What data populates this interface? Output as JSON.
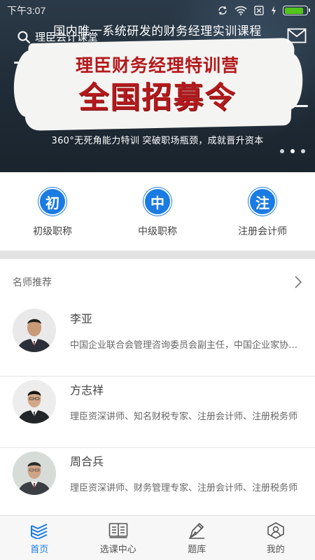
{
  "status_bar": {
    "time": "下午3:07",
    "battery_level": 0.85
  },
  "header": {
    "search_text": "理臣会计课堂"
  },
  "banner": {
    "top_line": "国内唯一系统研发的财务经理实训课程",
    "title_line1": "理臣财务经理特训营",
    "title_line2": "全国招募令",
    "subtitle": "360°无死角能力特训   突破职场瓶颈，成就晋升资本",
    "slide_count": 3,
    "active_slide": 2
  },
  "categories": [
    {
      "badge": "初",
      "label": "初级职称"
    },
    {
      "badge": "中",
      "label": "中级职称"
    },
    {
      "badge": "注",
      "label": "注册会计师"
    }
  ],
  "teachers_section": {
    "title": "名师推荐",
    "items": [
      {
        "name": "李亚",
        "desc": "中国企业联合会管理咨询委员会副主任，中国企业家协会理事"
      },
      {
        "name": "方志祥",
        "desc": "理臣资深讲师、知名财税专家、注册会计师、注册税务师"
      },
      {
        "name": "周合兵",
        "desc": "理臣资深讲师、财务管理专家、注册会计师、注册税务师"
      }
    ]
  },
  "bottom_nav": [
    {
      "label": "首页",
      "icon": "home-books-icon",
      "active": true
    },
    {
      "label": "选课中心",
      "icon": "open-book-icon",
      "active": false
    },
    {
      "label": "题库",
      "icon": "pen-icon",
      "active": false
    },
    {
      "label": "我的",
      "icon": "profile-icon",
      "active": false
    }
  ],
  "colors": {
    "accent": "#1a7be3",
    "banner_red": "#b3191c",
    "battery": "#52c41a"
  }
}
